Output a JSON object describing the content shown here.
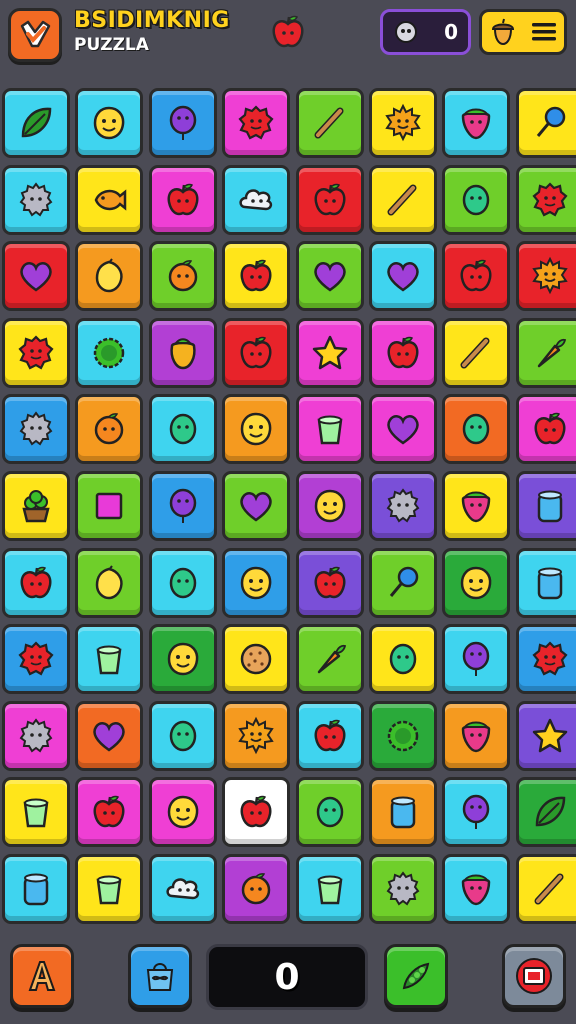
{
  "header": {
    "title_line1": "BSIDIMKNIG",
    "title_line2": "PUZZLA",
    "logo_icon": "check-badge-icon",
    "center_icon": "apple-icon",
    "counter_icon": "gear-face-icon",
    "counter_value": "0",
    "menu_icons": [
      "acorn-icon",
      "hamburger-menu-icon"
    ]
  },
  "board": {
    "rows": 11,
    "cols": 8,
    "tiles": [
      [
        {
          "bg": "#3fd4ef",
          "icon": "leaf"
        },
        {
          "bg": "#3fd4ef",
          "icon": "face"
        },
        {
          "bg": "#2f9ee8",
          "icon": "balloon"
        },
        {
          "bg": "#ef3fd4",
          "icon": "blob"
        },
        {
          "bg": "#6fcf2a",
          "icon": "stick"
        },
        {
          "bg": "#ffe51a",
          "icon": "sun"
        },
        {
          "bg": "#3fd4ef",
          "icon": "strawberry"
        },
        {
          "bg": "#ffe51a",
          "icon": "lollipop"
        }
      ],
      [
        {
          "bg": "#3fd4ef",
          "icon": "gear"
        },
        {
          "bg": "#ffe51a",
          "icon": "fish"
        },
        {
          "bg": "#ef3fd4",
          "icon": "apple"
        },
        {
          "bg": "#3fd4ef",
          "icon": "cloud"
        },
        {
          "bg": "#e8232a",
          "icon": "apple"
        },
        {
          "bg": "#ffe51a",
          "icon": "stick"
        },
        {
          "bg": "#6fcf2a",
          "icon": "egg"
        },
        {
          "bg": "#6fcf2a",
          "icon": "blob"
        }
      ],
      [
        {
          "bg": "#e8232a",
          "icon": "heart"
        },
        {
          "bg": "#f59a1f",
          "icon": "lemon"
        },
        {
          "bg": "#6fcf2a",
          "icon": "orange"
        },
        {
          "bg": "#ffe51a",
          "icon": "apple"
        },
        {
          "bg": "#6fcf2a",
          "icon": "heart"
        },
        {
          "bg": "#3fd4ef",
          "icon": "heart"
        },
        {
          "bg": "#e8232a",
          "icon": "apple"
        },
        {
          "bg": "#e8232a",
          "icon": "sun"
        }
      ],
      [
        {
          "bg": "#ffe51a",
          "icon": "blob"
        },
        {
          "bg": "#3fd4ef",
          "icon": "bush"
        },
        {
          "bg": "#b23fd4",
          "icon": "pepper"
        },
        {
          "bg": "#e8232a",
          "icon": "apple"
        },
        {
          "bg": "#ef3fd4",
          "icon": "star"
        },
        {
          "bg": "#ef3fd4",
          "icon": "apple"
        },
        {
          "bg": "#ffe51a",
          "icon": "stick"
        },
        {
          "bg": "#6fcf2a",
          "icon": "carrot"
        }
      ],
      [
        {
          "bg": "#2f9ee8",
          "icon": "gear"
        },
        {
          "bg": "#f59a1f",
          "icon": "orange"
        },
        {
          "bg": "#3fd4ef",
          "icon": "egg"
        },
        {
          "bg": "#f59a1f",
          "icon": "face"
        },
        {
          "bg": "#ef3fd4",
          "icon": "cup"
        },
        {
          "bg": "#ef3fd4",
          "icon": "heart"
        },
        {
          "bg": "#f26a23",
          "icon": "egg"
        },
        {
          "bg": "#ef3fd4",
          "icon": "apple"
        }
      ],
      [
        {
          "bg": "#ffe51a",
          "icon": "pot"
        },
        {
          "bg": "#6fcf2a",
          "icon": "square"
        },
        {
          "bg": "#2f9ee8",
          "icon": "balloon"
        },
        {
          "bg": "#6fcf2a",
          "icon": "heart"
        },
        {
          "bg": "#b23fd4",
          "icon": "face"
        },
        {
          "bg": "#7a4fd8",
          "icon": "gear"
        },
        {
          "bg": "#ffe51a",
          "icon": "strawberry"
        },
        {
          "bg": "#7a4fd8",
          "icon": "jar"
        }
      ],
      [
        {
          "bg": "#3fd4ef",
          "icon": "apple"
        },
        {
          "bg": "#6fcf2a",
          "icon": "lemon"
        },
        {
          "bg": "#3fd4ef",
          "icon": "egg"
        },
        {
          "bg": "#2f9ee8",
          "icon": "face"
        },
        {
          "bg": "#7a4fd8",
          "icon": "apple"
        },
        {
          "bg": "#6fcf2a",
          "icon": "lollipop"
        },
        {
          "bg": "#2aaa3a",
          "icon": "face"
        },
        {
          "bg": "#3fd4ef",
          "icon": "jar"
        }
      ],
      [
        {
          "bg": "#2f9ee8",
          "icon": "blob"
        },
        {
          "bg": "#3fd4ef",
          "icon": "cup"
        },
        {
          "bg": "#2aaa3a",
          "icon": "face"
        },
        {
          "bg": "#ffe51a",
          "icon": "cookie"
        },
        {
          "bg": "#6fcf2a",
          "icon": "carrot"
        },
        {
          "bg": "#ffe51a",
          "icon": "egg"
        },
        {
          "bg": "#3fd4ef",
          "icon": "balloon"
        },
        {
          "bg": "#2f9ee8",
          "icon": "blob"
        }
      ],
      [
        {
          "bg": "#ef3fd4",
          "icon": "gear"
        },
        {
          "bg": "#f26a23",
          "icon": "heart"
        },
        {
          "bg": "#3fd4ef",
          "icon": "egg"
        },
        {
          "bg": "#f59a1f",
          "icon": "sun"
        },
        {
          "bg": "#3fd4ef",
          "icon": "apple"
        },
        {
          "bg": "#2aaa3a",
          "icon": "bush"
        },
        {
          "bg": "#f59a1f",
          "icon": "strawberry"
        },
        {
          "bg": "#7a4fd8",
          "icon": "star"
        }
      ],
      [
        {
          "bg": "#ffe51a",
          "icon": "cup"
        },
        {
          "bg": "#ef3fd4",
          "icon": "apple"
        },
        {
          "bg": "#ef3fd4",
          "icon": "face"
        },
        {
          "bg": "#ffffff",
          "icon": "apple"
        },
        {
          "bg": "#6fcf2a",
          "icon": "egg"
        },
        {
          "bg": "#f59a1f",
          "icon": "jar"
        },
        {
          "bg": "#3fd4ef",
          "icon": "balloon"
        },
        {
          "bg": "#2aaa3a",
          "icon": "leaf"
        }
      ],
      [
        {
          "bg": "#3fd4ef",
          "icon": "jar"
        },
        {
          "bg": "#ffe51a",
          "icon": "cup"
        },
        {
          "bg": "#3fd4ef",
          "icon": "cloud"
        },
        {
          "bg": "#b23fd4",
          "icon": "orange"
        },
        {
          "bg": "#3fd4ef",
          "icon": "cup"
        },
        {
          "bg": "#6fcf2a",
          "icon": "gear"
        },
        {
          "bg": "#3fd4ef",
          "icon": "strawberry"
        },
        {
          "bg": "#ffe51a",
          "icon": "stick"
        }
      ]
    ]
  },
  "footer": {
    "left_button_icon": "letter-a-icon",
    "bag_button_icon": "gift-bag-icon",
    "score_value": "0",
    "leaf_button_icon": "pea-pod-icon",
    "right_button_icon": "film-exit-icon"
  }
}
